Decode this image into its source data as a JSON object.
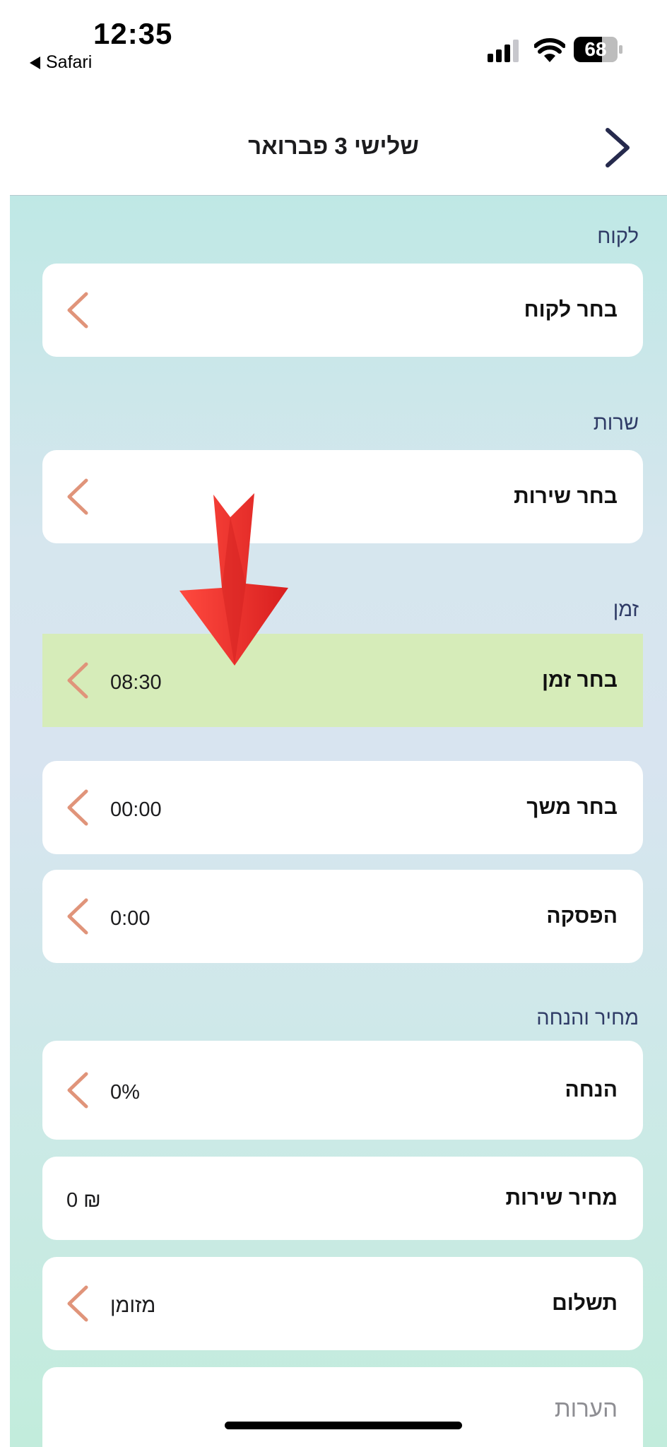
{
  "status_bar": {
    "time": "12:35",
    "back_app": "Safari",
    "battery": "68"
  },
  "header": {
    "title": "שלישי 3 פברואר"
  },
  "sections": {
    "customer": {
      "label": "לקוח",
      "row_label": "בחר לקוח"
    },
    "service": {
      "label": "שרות",
      "row_label": "בחר שירות"
    },
    "time": {
      "label": "זמן",
      "time_row": {
        "label": "בחר זמן",
        "value": "08:30"
      },
      "duration_row": {
        "label": "בחר משך",
        "value": "00:00"
      },
      "break_row": {
        "label": "הפסקה",
        "value": "0:00"
      }
    },
    "price": {
      "label": "מחיר והנחה",
      "discount_row": {
        "label": "הנחה",
        "value": "0%"
      },
      "service_price_row": {
        "label": "מחיר שירות",
        "value": "0 ₪"
      },
      "payment_row": {
        "label": "תשלום",
        "value": "מזומן"
      }
    },
    "notes": {
      "placeholder": "הערות"
    }
  },
  "colors": {
    "accent_chevron": "#e0947a",
    "highlight_row": "#d6ecb9",
    "section_label": "#2f3b66",
    "arrow": "#f0302e"
  },
  "icons": [
    "signal-icon",
    "wifi-icon",
    "battery-icon",
    "chevron-right-icon",
    "chevron-left-icon",
    "red-arrow-annotation"
  ]
}
